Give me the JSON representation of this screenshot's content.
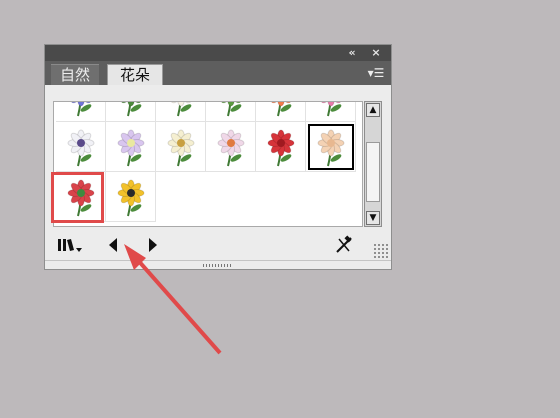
{
  "panel": {
    "tabs": [
      {
        "label": "自然",
        "active": false
      },
      {
        "label": "花朵",
        "active": true
      }
    ]
  },
  "icons": {
    "collapse": "double-chevron-left-icon",
    "close": "close-icon",
    "menu": "panel-menu-icon",
    "library": "symbol-library-menu-icon",
    "prev": "previous-library-icon",
    "next": "next-library-icon",
    "break_link": "break-link-icon"
  },
  "swatches": [
    {
      "name": "aster",
      "petal": "#6f73d6",
      "center": "#e8c440"
    },
    {
      "name": "green-stem",
      "petal": "#4b8a3a",
      "center": "#4b8a3a"
    },
    {
      "name": "white-daisy",
      "petal": "#f7f3e6",
      "center": "#e5b640"
    },
    {
      "name": "green-leaves",
      "petal": "#5a9a3e",
      "center": "#5a9a3e"
    },
    {
      "name": "orange-gerbera",
      "petal": "#f07a4a",
      "center": "#9a5a2a"
    },
    {
      "name": "pink-hibiscus",
      "petal": "#e77aa8",
      "center": "#c2396d"
    },
    {
      "name": "white-iris",
      "petal": "#f1f1f6",
      "center": "#5a4a8a"
    },
    {
      "name": "lotus",
      "petal": "#d9c6ef",
      "center": "#e9e9a0"
    },
    {
      "name": "lily-bouquet",
      "petal": "#f5efd1",
      "center": "#c8a040"
    },
    {
      "name": "echinacea",
      "petal": "#f0d8e8",
      "center": "#e07a40"
    },
    {
      "name": "red-rose",
      "petal": "#d6343a",
      "center": "#a01a20"
    },
    {
      "name": "peach-rose",
      "petal": "#f4d2b4",
      "center": "#e8b890"
    },
    {
      "name": "rose-bud",
      "petal": "#d9434a",
      "center": "#3f8a3f"
    },
    {
      "name": "sunflower",
      "petal": "#f2c12a",
      "center": "#2a2a2a"
    }
  ],
  "selected_index": 11,
  "colors": {
    "annotation": "#e04a4a",
    "panel_dark": "#4a4a4a",
    "background": "#bdb9bb"
  }
}
